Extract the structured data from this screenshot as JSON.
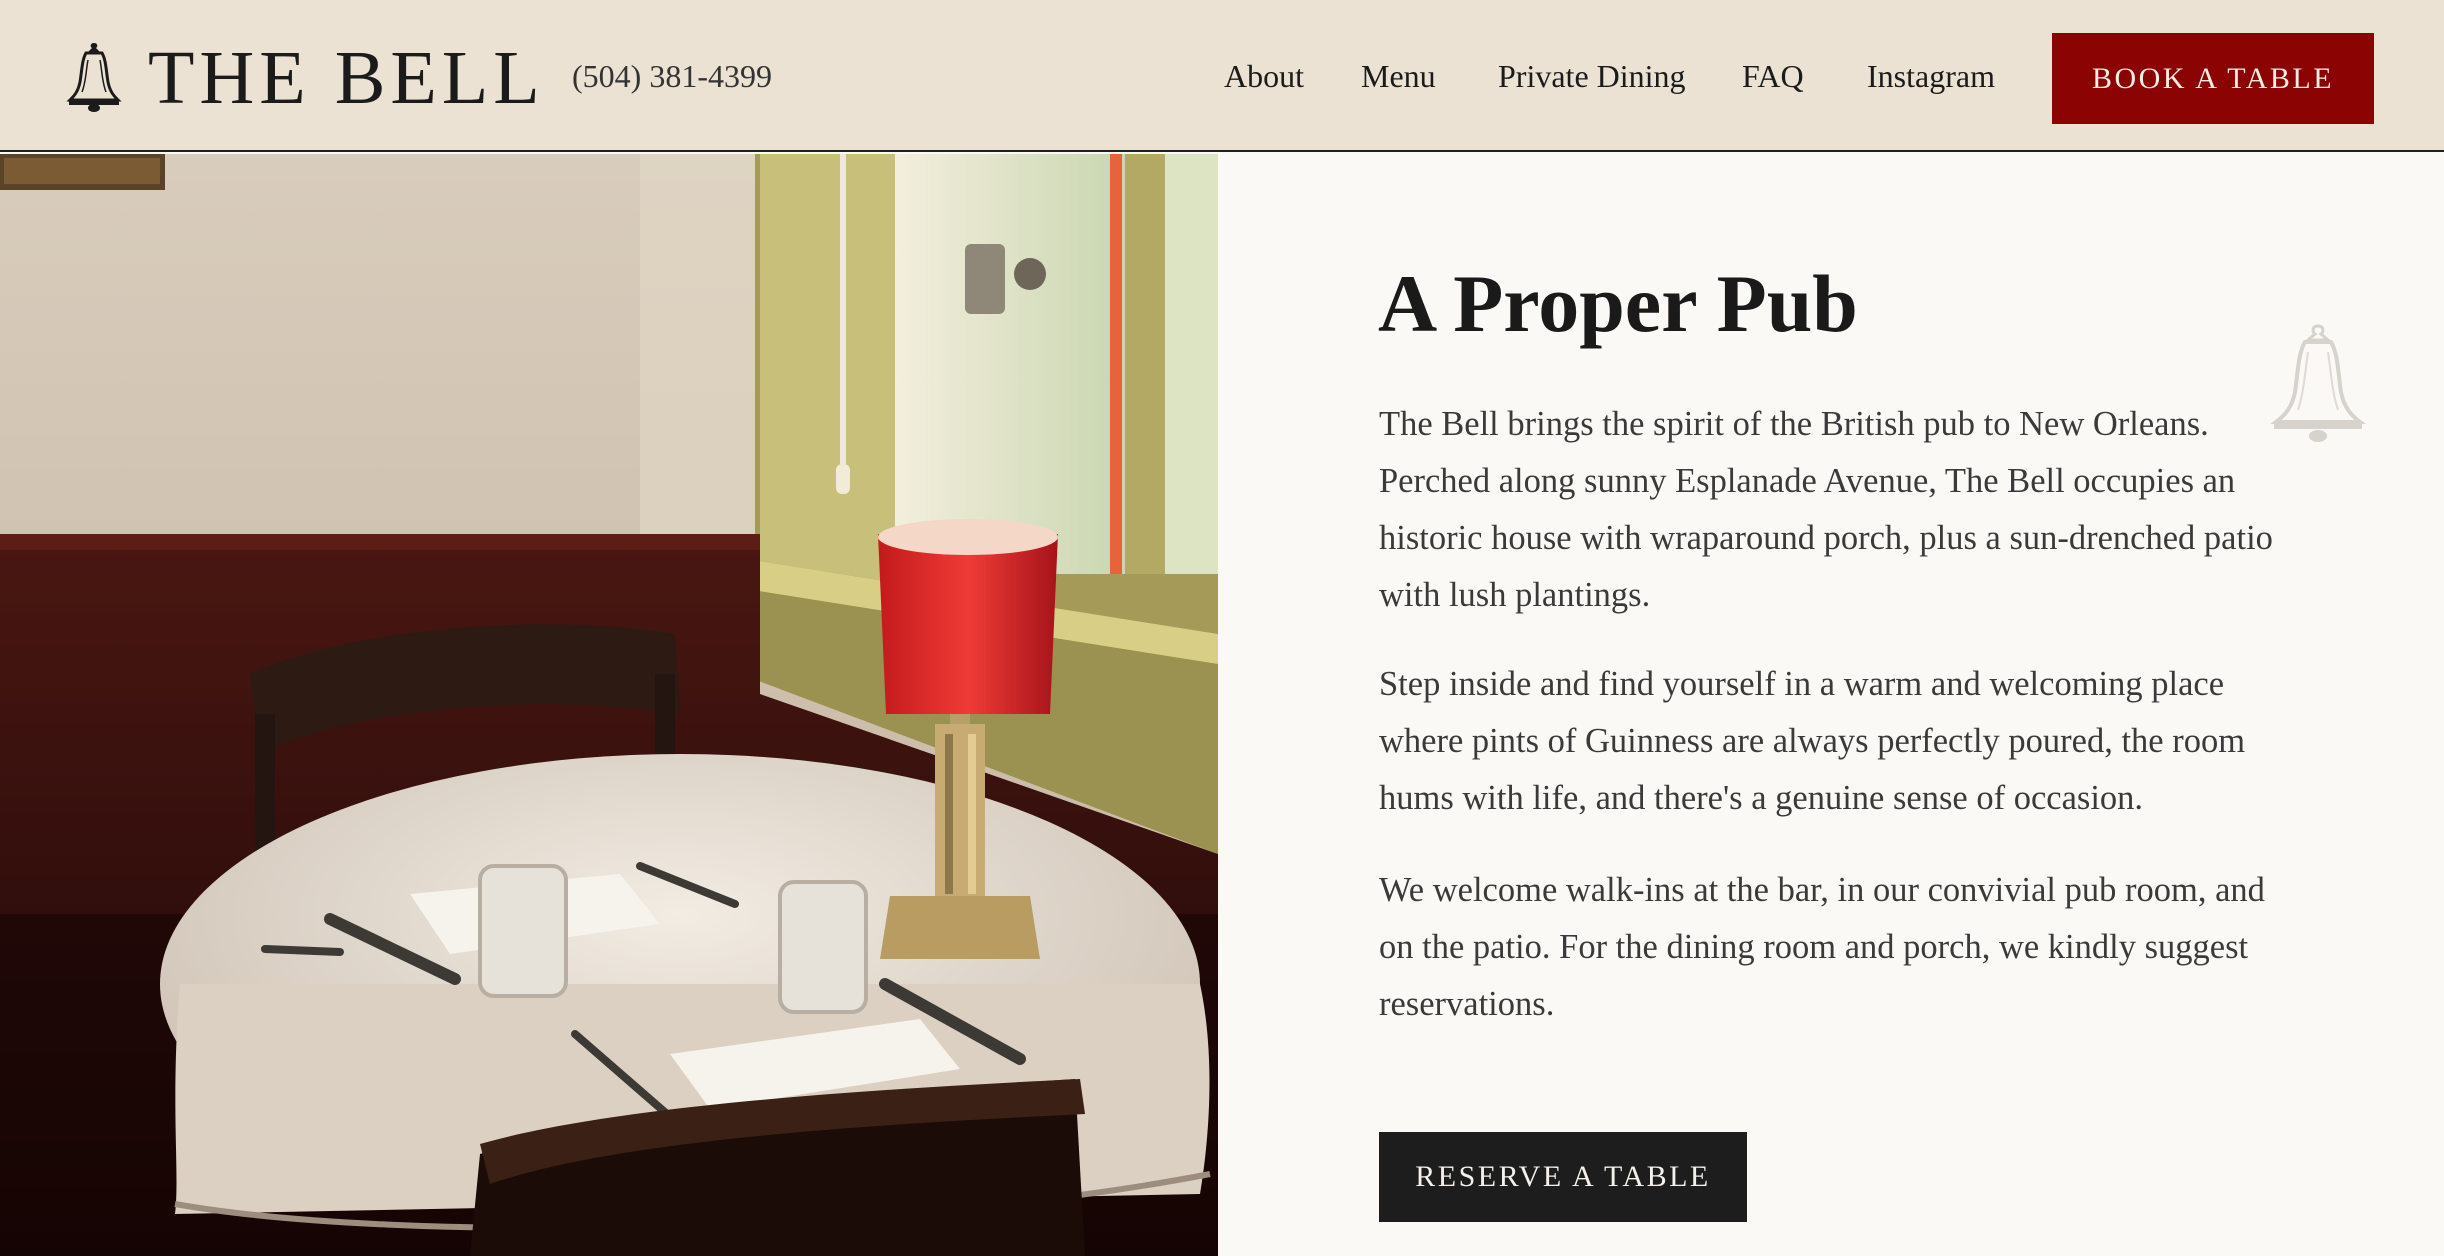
{
  "header": {
    "brand": "THE BELL",
    "logo_icon": "bell-icon",
    "phone": "(504) 381-4399",
    "nav": [
      {
        "label": "About"
      },
      {
        "label": "Menu"
      },
      {
        "label": "Private Dining"
      },
      {
        "label": "FAQ"
      },
      {
        "label": "Instagram"
      }
    ],
    "book_label": "BOOK A TABLE"
  },
  "hero": {
    "photo_icon": "dining-table-photo",
    "heading": "A Proper Pub",
    "paragraphs": [
      "The Bell brings the spirit of the British pub to New Orleans. Perched along sunny Esplanade Avenue, The Bell occupies an historic house with wraparound porch, plus a sun-drenched patio with lush plantings.",
      "Step inside and find yourself in a warm and welcoming place where pints of Guinness are always perfectly poured, the room hums with life, and there's a genuine sense of occasion.",
      "We welcome walk-ins at the bar, in our convivial pub room, and on the patio. For the dining room and porch, we kindly suggest reservations."
    ],
    "watermark_icon": "bell-watermark-icon",
    "reserve_label": "RESERVE A TABLE"
  },
  "colors": {
    "header_bg": "#ebe2d4",
    "accent_red": "#8c0303",
    "dark_button": "#1d1d1d",
    "content_bg": "#faf9f6"
  }
}
